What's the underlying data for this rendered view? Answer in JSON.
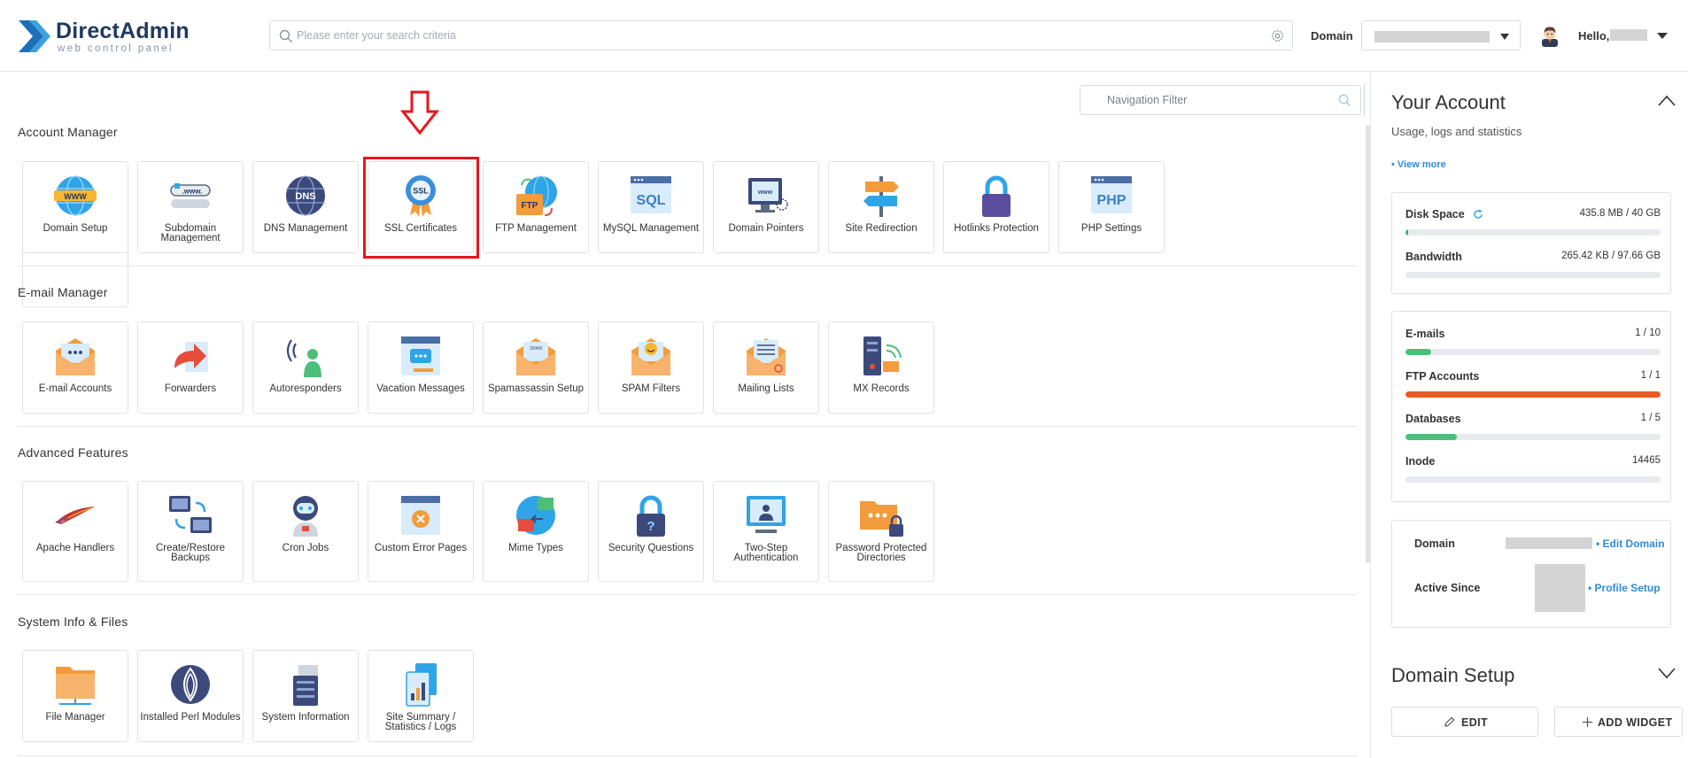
{
  "header": {
    "logo_title": "DirectAdmin",
    "logo_subtitle": "web control panel",
    "search_placeholder": "Please enter your search criteria",
    "domain_label": "Domain",
    "hello_label": "Hello,"
  },
  "nav_filter": {
    "placeholder": "Navigation Filter"
  },
  "sections": {
    "account": {
      "title": "Account Manager",
      "tiles": [
        {
          "label": "Domain Setup",
          "icon": "globe-www-icon"
        },
        {
          "label": "Subdomain Management",
          "icon": "subdomain-icon"
        },
        {
          "label": "DNS Management",
          "icon": "dns-globe-icon"
        },
        {
          "label": "SSL Certificates",
          "icon": "ssl-badge-icon"
        },
        {
          "label": "FTP Management",
          "icon": "ftp-folder-icon"
        },
        {
          "label": "MySQL Management",
          "icon": "sql-window-icon"
        },
        {
          "label": "Domain Pointers",
          "icon": "domain-pointer-icon"
        },
        {
          "label": "Site Redirection",
          "icon": "signpost-icon"
        },
        {
          "label": "Hotlinks Protection",
          "icon": "padlock-icon"
        },
        {
          "label": "PHP Settings",
          "icon": "php-window-icon"
        }
      ]
    },
    "email": {
      "title": "E-mail Manager",
      "tiles": [
        {
          "label": "E-mail Accounts",
          "icon": "envelope-icon"
        },
        {
          "label": "Forwarders",
          "icon": "forward-arrow-icon"
        },
        {
          "label": "Autoresponders",
          "icon": "autoresponder-icon"
        },
        {
          "label": "Vacation Messages",
          "icon": "vacation-message-icon"
        },
        {
          "label": "Spamassassin Setup",
          "icon": "spam-envelope-icon"
        },
        {
          "label": "SPAM Filters",
          "icon": "spam-filter-icon"
        },
        {
          "label": "Mailing Lists",
          "icon": "mailing-list-icon"
        },
        {
          "label": "MX Records",
          "icon": "mx-server-icon"
        }
      ]
    },
    "advanced": {
      "title": "Advanced Features",
      "tiles": [
        {
          "label": "Apache Handlers",
          "icon": "apache-feather-icon"
        },
        {
          "label": "Create/Restore Backups",
          "icon": "backup-monitors-icon"
        },
        {
          "label": "Cron Jobs",
          "icon": "robot-icon"
        },
        {
          "label": "Custom Error Pages",
          "icon": "error-page-icon"
        },
        {
          "label": "Mime Types",
          "icon": "mime-types-icon"
        },
        {
          "label": "Security Questions",
          "icon": "security-lock-icon"
        },
        {
          "label": "Two-Step Authentication",
          "icon": "two-step-auth-icon"
        },
        {
          "label": "Password Protected Directories",
          "icon": "protected-folder-icon"
        }
      ]
    },
    "system": {
      "title": "System Info & Files",
      "tiles": [
        {
          "label": "File Manager",
          "icon": "file-manager-icon"
        },
        {
          "label": "Installed Perl Modules",
          "icon": "perl-onion-icon"
        },
        {
          "label": "System Information",
          "icon": "server-info-icon"
        },
        {
          "label": "Site Summary / Statistics / Logs",
          "icon": "statistics-icon"
        }
      ]
    }
  },
  "sidebar": {
    "account_title": "Your Account",
    "account_subtitle": "Usage, logs and statistics",
    "view_more": "• View more",
    "usage": [
      {
        "name": "Disk Space",
        "value": "435.8 MB / 40 GB",
        "fraction": 0.011,
        "color": "#3cb371"
      },
      {
        "name": "Bandwidth",
        "value": "265.42 KB / 97.66 GB",
        "fraction": 0.0,
        "color": "#3cb371"
      }
    ],
    "limits": [
      {
        "name": "E-mails",
        "value": "1 / 10",
        "fraction": 0.1,
        "color": "#4cbf7a"
      },
      {
        "name": "FTP Accounts",
        "value": "1 / 1",
        "fraction": 1.0,
        "color": "#ea5b25"
      },
      {
        "name": "Databases",
        "value": "1 / 5",
        "fraction": 0.2,
        "color": "#4cbf7a"
      },
      {
        "name": "Inode",
        "value": "14465",
        "fraction": 0.0,
        "color": "#4cbf7a"
      }
    ],
    "domain_label": "Domain",
    "edit_domain": "• Edit Domain",
    "active_since_label": "Active Since",
    "profile_setup": "• Profile Setup",
    "domain_setup_title": "Domain Setup",
    "edit_button": "EDIT",
    "add_widget_button": "ADD WIDGET"
  }
}
